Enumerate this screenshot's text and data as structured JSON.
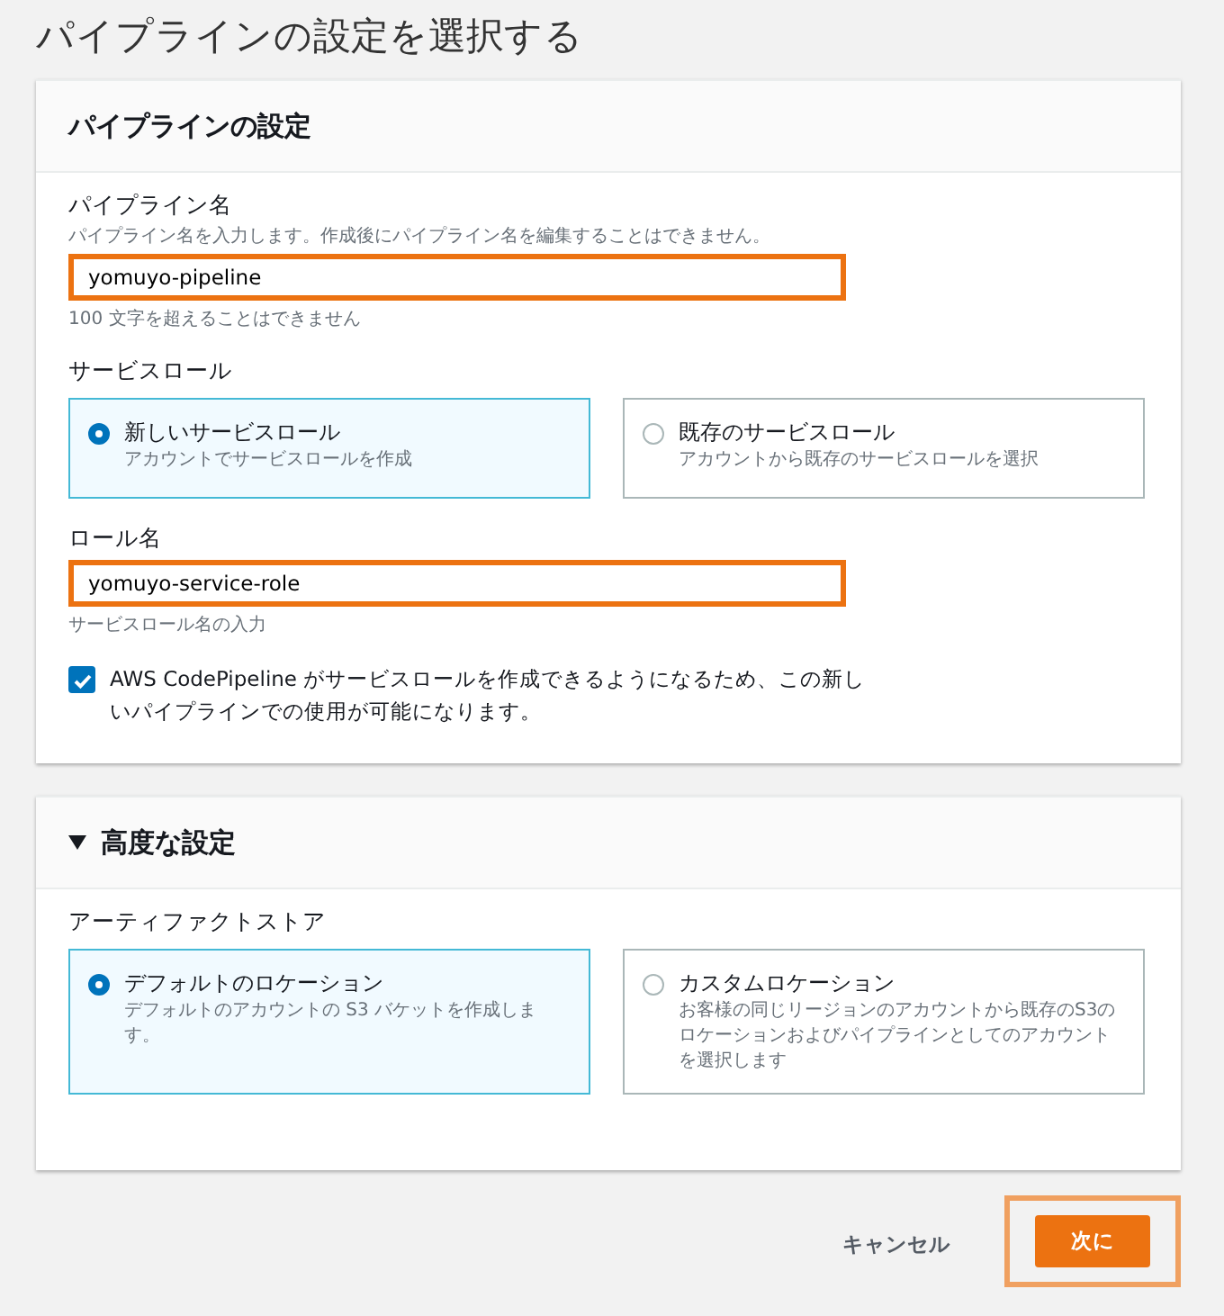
{
  "page_title": "パイプラインの設定を選択する",
  "sections": [
    {
      "title": "パイプラインの設定",
      "fields": [
        {
          "kind": "text",
          "label": "パイプライン名",
          "description": "パイプライン名を入力します。作成後にパイプライン名を編集することはできません。",
          "value": "yomuyo-pipeline",
          "highlighted": true,
          "hint": "100 文字を超えることはできません"
        },
        {
          "kind": "tiles",
          "label": "サービスロール",
          "options": [
            {
              "title": "新しいサービスロール",
              "description": "アカウントでサービスロールを作成",
              "selected": true
            },
            {
              "title": "既存のサービスロール",
              "description": "アカウントから既存のサービスロールを選択",
              "selected": false
            }
          ]
        },
        {
          "kind": "text",
          "label": "ロール名",
          "value": "yomuyo-service-role",
          "highlighted": true,
          "hint": "サービスロール名の入力"
        },
        {
          "kind": "checkbox",
          "label": "AWS CodePipeline がサービスロールを作成できるようになるため、この新しいパイプラインでの使用が可能になります。",
          "checked": true
        }
      ]
    },
    {
      "title": "高度な設定",
      "expanded": true,
      "fields": [
        {
          "kind": "tiles",
          "label": "アーティファクトストア",
          "options": [
            {
              "title": "デフォルトのロケーション",
              "description": "デフォルトのアカウントの S3 バケットを作成します。",
              "selected": true
            },
            {
              "title": "カスタムロケーション",
              "description": "お客様の同じリージョンのアカウントから既存のS3のロケーションおよびパイプラインとしてのアカウントを選択します",
              "selected": false
            }
          ]
        }
      ]
    }
  ],
  "actions": [
    {
      "kind": "link",
      "label": "キャンセル"
    },
    {
      "kind": "primary",
      "label": "次に",
      "highlighted": true
    }
  ]
}
